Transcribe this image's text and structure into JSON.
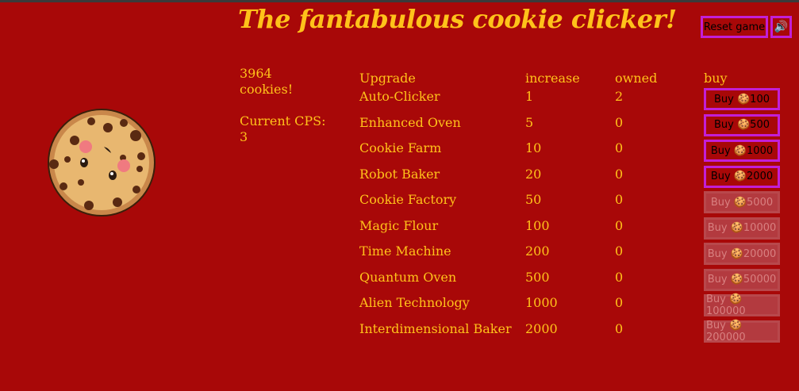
{
  "title": "The fantabulous cookie clicker!",
  "controls": {
    "reset_label": "Reset game",
    "sound_icon": "🔊"
  },
  "stats": {
    "cookies_count": "3964",
    "cookies_label": "cookies!",
    "cps_label": "Current CPS:",
    "cps_value": "3"
  },
  "table": {
    "headers": {
      "upgrade": "Upgrade",
      "increase": "increase",
      "owned": "owned",
      "buy": "buy"
    },
    "rows": [
      {
        "name": "Auto-Clicker",
        "increase": "1",
        "owned": "2",
        "buy": "Buy 🍪100",
        "enabled": true
      },
      {
        "name": "Enhanced Oven",
        "increase": "5",
        "owned": "0",
        "buy": "Buy 🍪500",
        "enabled": true
      },
      {
        "name": "Cookie Farm",
        "increase": "10",
        "owned": "0",
        "buy": "Buy 🍪1000",
        "enabled": true
      },
      {
        "name": "Robot Baker",
        "increase": "20",
        "owned": "0",
        "buy": "Buy 🍪2000",
        "enabled": true
      },
      {
        "name": "Cookie Factory",
        "increase": "50",
        "owned": "0",
        "buy": "Buy 🍪5000",
        "enabled": false
      },
      {
        "name": "Magic Flour",
        "increase": "100",
        "owned": "0",
        "buy": "Buy 🍪10000",
        "enabled": false
      },
      {
        "name": "Time Machine",
        "increase": "200",
        "owned": "0",
        "buy": "Buy 🍪20000",
        "enabled": false
      },
      {
        "name": "Quantum Oven",
        "increase": "500",
        "owned": "0",
        "buy": "Buy 🍪50000",
        "enabled": false
      },
      {
        "name": "Alien Technology",
        "increase": "1000",
        "owned": "0",
        "buy": "Buy 🍪100000",
        "enabled": false
      },
      {
        "name": "Interdimensional Baker",
        "increase": "2000",
        "owned": "0",
        "buy": "Buy 🍪200000",
        "enabled": false
      }
    ]
  },
  "colors": {
    "background": "#a80808",
    "text": "#ffc21a",
    "button_border": "#c21fd6",
    "disabled_button": "#b33a3f"
  }
}
